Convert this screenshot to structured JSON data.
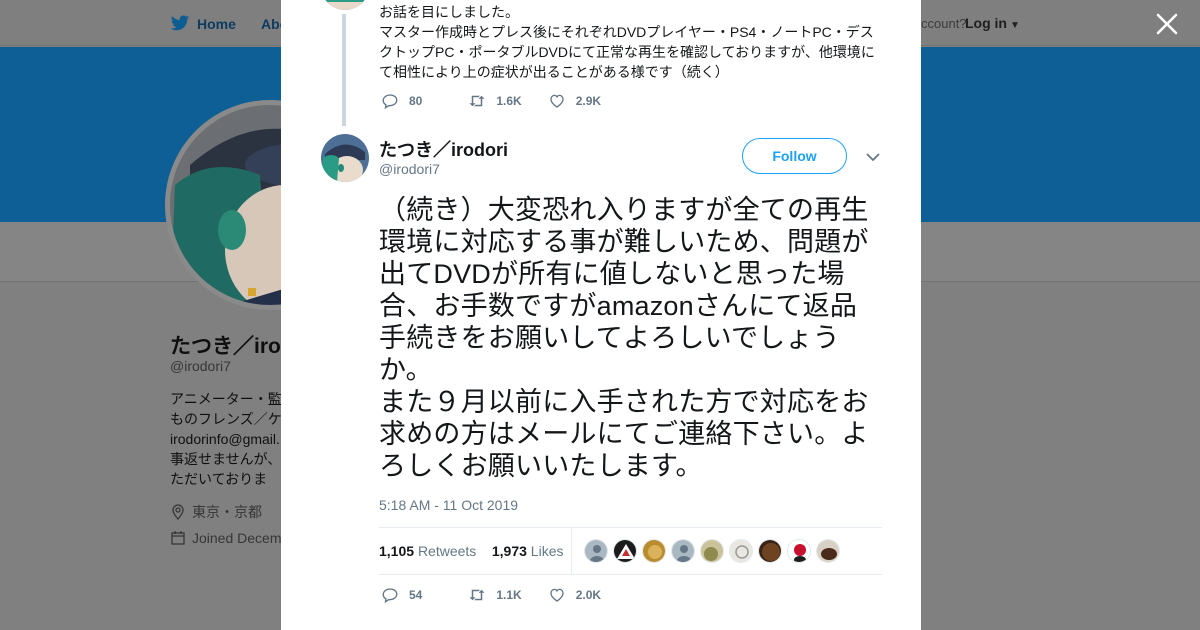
{
  "nav": {
    "home_label": "Home",
    "about_label": "Abo",
    "account_prompt": "ccount?",
    "login_label": "Log in"
  },
  "profile": {
    "name": "たつき／iro",
    "handle": "@irodori7",
    "bio_lines": [
      "アニメーター・監",
      "ものフレンズ／ケ",
      "irodorinfo@gmail.",
      "事返せませんが、",
      "ただいておりま"
    ],
    "location": "東京・京都",
    "joined": "Joined Decem"
  },
  "previous_tweet": {
    "text": "お話を目にしました。\nマスター作成時とプレス後にそれぞれDVDプレイヤー・PS4・ノートPC・デスクトップPC・ポータブルDVDにて正常な再生を確認しておりますが、他環境にて相性により上の症状が出ることがある様です（続く）",
    "replies": "80",
    "retweets": "1.6K",
    "likes": "2.9K"
  },
  "tweet": {
    "author_name": "たつき／irodori",
    "author_handle": "@irodori7",
    "follow_label": "Follow",
    "text": "（続き）大変恐れ入りますが全ての再生環境に対応する事が難しいため、問題が出てDVDが所有に値しないと思った場合、お手数ですがamazonさんにて返品手続きをお願いしてよろしいでしょうか。\nまた９月以前に入手された方で対応をお求めの方はメールにてご連絡下さい。よろしくお願いいたします。",
    "timestamp": "5:18 AM - 11 Oct 2019",
    "retweet_count": "1,105",
    "retweet_label": "Retweets",
    "like_count": "1,973",
    "like_label": "Likes",
    "replies": "54",
    "retweets": "1.1K",
    "likes": "2.0K"
  },
  "colors": {
    "accent": "#1da1f2",
    "text_secondary": "#657786",
    "overlay": "#808080",
    "header_banner": "#0e5f95"
  }
}
